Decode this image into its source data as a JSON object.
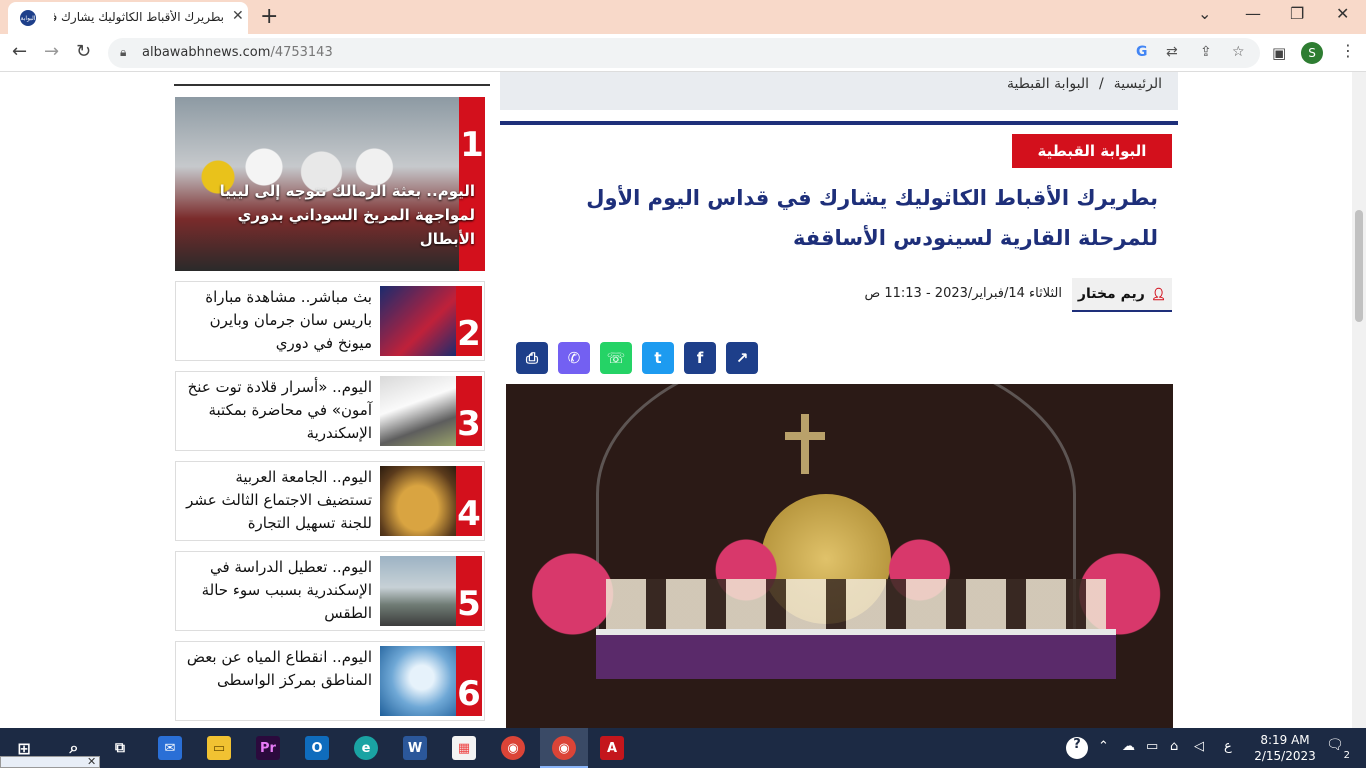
{
  "browser": {
    "tab_title": "بطريرك الأقباط الكاثوليك يشارك في",
    "favicon_text": "البوابة",
    "url_domain": "albawabhnews.com",
    "url_path": "/4753143",
    "profile_initial": "S"
  },
  "breadcrumb": {
    "home": "الرئيسية",
    "separator": "/",
    "section": "البوابة القبطية"
  },
  "article": {
    "category": "البوابة القبطية",
    "title": "بطريرك الأقباط الكاثوليك يشارك في قداس اليوم الأول للمرحلة القارية لسينودس الأساقفة",
    "author": "ريم مختار",
    "date": "الثلاثاء 14/فبراير/2023 - 11:13 ص"
  },
  "share": {
    "colors": {
      "share": "#1e3f8a",
      "facebook": "#1e3f8a",
      "twitter": "#1d9bf0",
      "whatsapp": "#25d366",
      "viber": "#7360f2",
      "print": "#1e3f8a"
    }
  },
  "sidebar": {
    "hero": {
      "rank": "1",
      "caption": "اليوم.. بعثة الزمالك تتوجه إلى ليبيا لمواجهة المريخ السوداني بدوري الأبطال"
    },
    "items": [
      {
        "rank": "2",
        "text": "بث مباشر.. مشاهدة مباراة باريس سان جرمان وبايرن ميونخ في دوري"
      },
      {
        "rank": "3",
        "text": "اليوم.. «أسرار قلادة توت عنخ آمون» في محاضرة بمكتبة الإسكندرية"
      },
      {
        "rank": "4",
        "text": "اليوم.. الجامعة العربية تستضيف الاجتماع الثالث عشر للجنة تسهيل التجارة"
      },
      {
        "rank": "5",
        "text": "اليوم.. تعطيل الدراسة في الإسكندرية بسبب سوء حالة الطقس"
      },
      {
        "rank": "6",
        "text": "اليوم.. انقطاع المياه عن بعض المناطق بمركز الواسطى"
      }
    ]
  },
  "taskbar": {
    "time": "8:19 AM",
    "date": "2/15/2023",
    "notifications": "2",
    "lang": "ع"
  },
  "colors": {
    "brand_red": "#d3101c",
    "brand_blue": "#1e2f7a"
  }
}
